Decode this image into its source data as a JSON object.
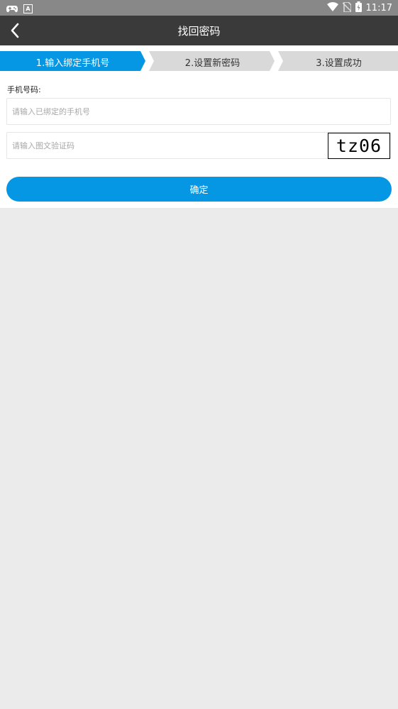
{
  "status_bar": {
    "time": "11:17",
    "icons_left": [
      "gamepad-icon",
      "a-badge-icon"
    ],
    "icons_right": [
      "wifi-icon",
      "no-sim-icon",
      "battery-icon"
    ]
  },
  "header": {
    "title": "找回密码",
    "back_icon": "chevron-left-icon"
  },
  "steps": [
    {
      "label": "1.输入绑定手机号",
      "active": true
    },
    {
      "label": "2.设置新密码",
      "active": false
    },
    {
      "label": "3.设置成功",
      "active": false
    }
  ],
  "form": {
    "phone_label": "手机号码:",
    "phone_placeholder": "请输入已绑定的手机号",
    "phone_value": "",
    "captcha_placeholder": "请输入图文验证码",
    "captcha_value": "",
    "captcha_image_text": "tz06",
    "confirm_label": "确定"
  },
  "colors": {
    "accent": "#0597e4",
    "step_inactive": "#d9d9d9",
    "header_bg": "#3a3a3a",
    "statusbar_bg": "#888888",
    "page_bg": "#ebebeb"
  }
}
